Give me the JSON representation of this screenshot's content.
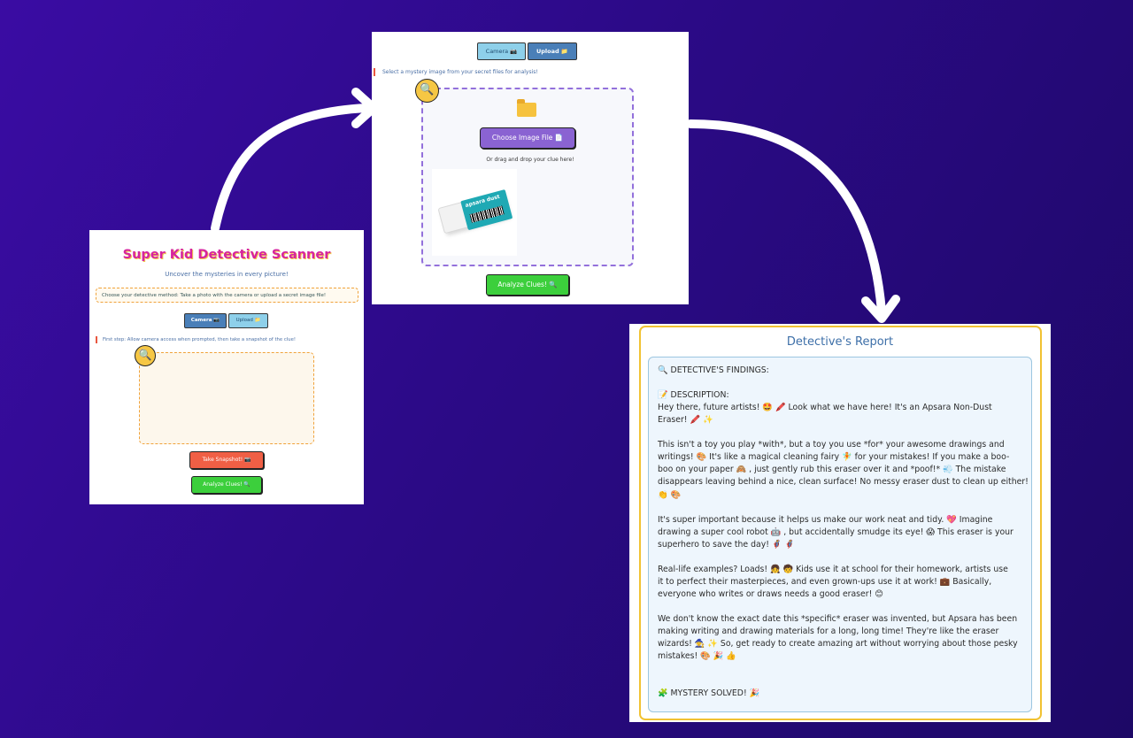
{
  "colors": {
    "background": "#2b0a86",
    "title_pink": "#d6249f",
    "tab_active": "#4a7fb8",
    "tab_inactive": "#8ed0ea",
    "snapshot_red": "#f05f45",
    "analyze_green": "#3ccf3c",
    "choose_purple": "#8a63d2",
    "report_border": "#f1c232"
  },
  "scanner": {
    "title": "Super Kid Detective Scanner",
    "subtitle": "Uncover the mysteries in every picture!",
    "method_text": "Choose your detective method: Take a photo with the camera or upload a secret image file!",
    "tabs": [
      {
        "label": "Camera 📷",
        "active": true
      },
      {
        "label": "Upload 📁",
        "active": false
      }
    ],
    "instruction": "First step: Allow camera access when prompted, then take a snapshot of the clue!",
    "magnifier_icon": "🔍",
    "snapshot_button": "Take Snapshot! 📷",
    "analyze_button": "Analyze Clues! 🔍"
  },
  "upload": {
    "tabs": [
      {
        "label": "Camera 📷",
        "active": false
      },
      {
        "label": "Upload 📁",
        "active": true
      }
    ],
    "instruction": "Select a mystery image from your secret files for analysis!",
    "magnifier_icon": "🔍",
    "folder_icon": "folder-icon",
    "choose_button": "Choose Image File 📄",
    "drag_text": "Or drag and drop your clue here!",
    "thumbnail_brand": "apsara dust",
    "analyze_button": "Analyze Clues! 🔍"
  },
  "report": {
    "title": "Detective's Report",
    "lines": [
      "🔍 DETECTIVE'S FINDINGS:",
      "",
      "📝 DESCRIPTION:",
      "Hey there, future artists! 🤩 🖍️  Look what we have here! It's an Apsara Non-Dust",
      "Eraser! 🖍️ ✨",
      "",
      "This isn't a toy you play *with*, but a toy you use *for* your awesome drawings and",
      "writings! 🎨  It's like a magical cleaning fairy 🧚 for your mistakes!  If you make a boo-",
      "boo on your paper 🙈 ,  just gently rub this eraser over it and *poof!* 💨  The mistake",
      "disappears leaving behind a nice, clean surface! No messy eraser dust to clean up either!",
      "👏 🎨",
      "",
      "It's super important because it helps us make our work neat and tidy. 💖  Imagine",
      "drawing a super cool robot 🤖 , but accidentally smudge its eye! 😱  This eraser is your",
      "superhero to save the day! 🦸 🦸",
      "",
      "Real-life examples?  Loads!  👧 🧒  Kids use it at school for their homework, artists use",
      "it to perfect their masterpieces, and even grown-ups use it at work!  💼  Basically,",
      "everyone who writes or draws needs a good eraser!  😊",
      "",
      "We don't know the exact date this *specific* eraser was invented, but Apsara has been",
      "making writing and drawing materials for a long, long time!  They're like the eraser",
      "wizards! 🧙 ✨  So, get ready to create amazing art without worrying about those pesky",
      "mistakes!  🎨 🎉 👍",
      "",
      "",
      "🧩 MYSTERY SOLVED! 🎉"
    ]
  }
}
